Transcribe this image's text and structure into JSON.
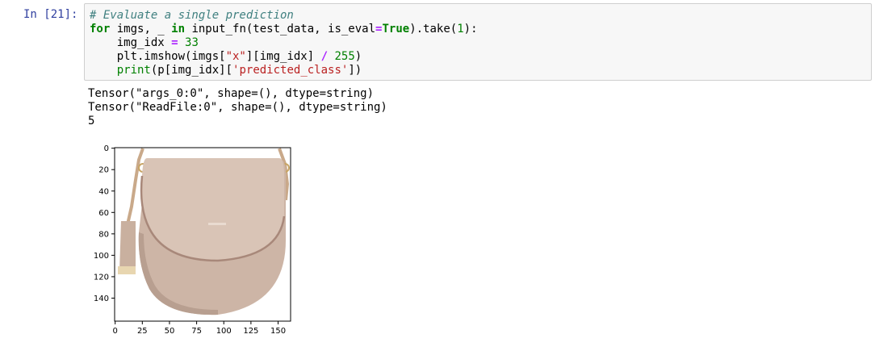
{
  "cell": {
    "prompt": "In [21]:",
    "code_lines": [
      [
        {
          "t": "# Evaluate a single prediction",
          "c": "cm-comment"
        }
      ],
      [
        {
          "t": "for",
          "c": "cm-kw"
        },
        {
          "t": " imgs, _ ",
          "c": ""
        },
        {
          "t": "in",
          "c": "cm-kw"
        },
        {
          "t": " input_fn(test_data, is_eval",
          "c": ""
        },
        {
          "t": "=",
          "c": "cm-op"
        },
        {
          "t": "True",
          "c": "cm-kw"
        },
        {
          "t": ").take(",
          "c": ""
        },
        {
          "t": "1",
          "c": "cm-num"
        },
        {
          "t": "):",
          "c": ""
        }
      ],
      [
        {
          "t": "    img_idx ",
          "c": ""
        },
        {
          "t": "=",
          "c": "cm-op"
        },
        {
          "t": " ",
          "c": ""
        },
        {
          "t": "33",
          "c": "cm-num"
        }
      ],
      [
        {
          "t": "    plt.imshow(imgs[",
          "c": ""
        },
        {
          "t": "\"x\"",
          "c": "cm-str"
        },
        {
          "t": "][img_idx] ",
          "c": ""
        },
        {
          "t": "/",
          "c": "cm-op"
        },
        {
          "t": " ",
          "c": ""
        },
        {
          "t": "255",
          "c": "cm-num"
        },
        {
          "t": ")",
          "c": ""
        }
      ],
      [
        {
          "t": "    ",
          "c": ""
        },
        {
          "t": "print",
          "c": "cm-builtin"
        },
        {
          "t": "(p[img_idx][",
          "c": ""
        },
        {
          "t": "'predicted_class'",
          "c": "cm-str"
        },
        {
          "t": "])",
          "c": ""
        }
      ]
    ]
  },
  "output": {
    "lines": [
      "Tensor(\"args_0:0\", shape=(), dtype=string)",
      "Tensor(\"ReadFile:0\", shape=(), dtype=string)",
      "5"
    ]
  },
  "plot": {
    "y_ticks": [
      "0",
      "20",
      "40",
      "60",
      "80",
      "100",
      "120",
      "140"
    ],
    "x_ticks": [
      "0",
      "25",
      "50",
      "75",
      "100",
      "125",
      "150"
    ],
    "image_description_colors": {
      "bag": "#cdb5a6",
      "bag_shadow": "#b89f90",
      "flap": "#d9c4b6",
      "strap": "#c9a98a",
      "hardware": "#c8a564"
    }
  }
}
